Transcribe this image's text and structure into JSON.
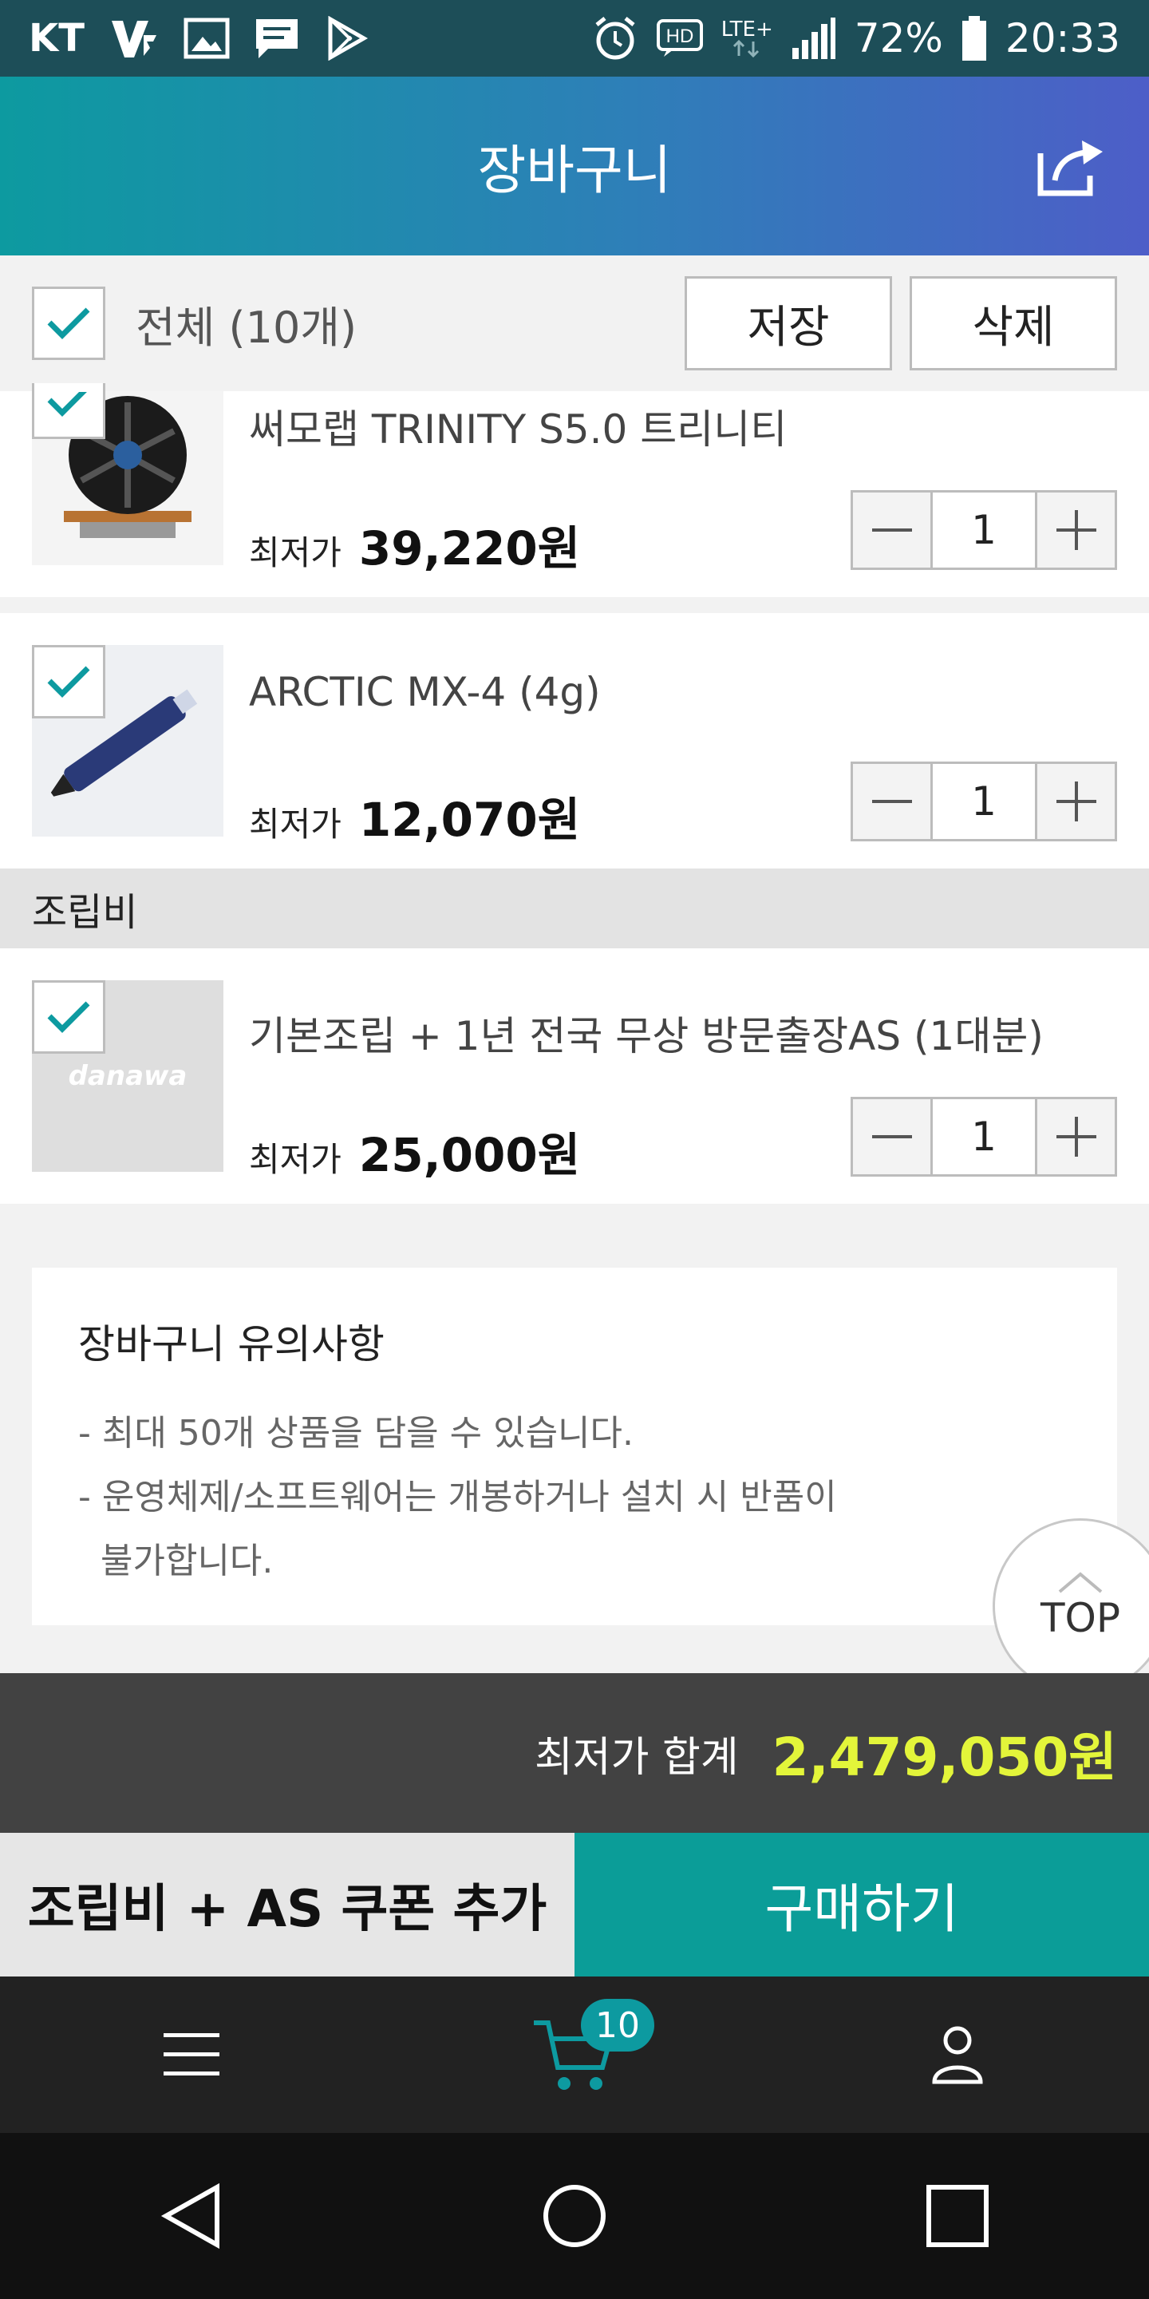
{
  "status_bar": {
    "carrier": "KT",
    "network": "LTE+",
    "battery": "72%",
    "time": "20:33"
  },
  "header": {
    "title": "장바구니"
  },
  "select_bar": {
    "all_label": "전체 (10개)",
    "save_label": "저장",
    "delete_label": "삭제"
  },
  "items": [
    {
      "name": "써모랩 TRINITY S5.0 트리니티",
      "price_label": "최저가",
      "price": "39,220원",
      "qty": "1"
    },
    {
      "name": "ARCTIC MX-4 (4g)",
      "price_label": "최저가",
      "price": "12,070원",
      "qty": "1"
    }
  ],
  "assembly_section": {
    "title": "조립비",
    "item": {
      "name": "기본조립 + 1년 전국 무상 방문출장AS (1대분)",
      "price_label": "최저가",
      "price": "25,000원",
      "qty": "1",
      "thumb_logo": "danawa"
    }
  },
  "notice": {
    "title": "장바구니 유의사항",
    "lines": [
      "- 최대 50개 상품을 담을 수 있습니다.",
      "- 운영체제/소프트웨어는 개봉하거나 설치 시 반품이",
      "불가합니다."
    ]
  },
  "top_button": {
    "label": "TOP"
  },
  "total": {
    "label": "최저가 합계",
    "value": "2,479,050원"
  },
  "actions": {
    "coupon_label": "조립비 + AS 쿠폰 추가",
    "buy_label": "구매하기"
  },
  "bottom_nav": {
    "cart_count": "10"
  },
  "colors": {
    "accent": "#0d9aa0",
    "total_value": "#e3f53a",
    "buy_button": "#0b9d98"
  }
}
